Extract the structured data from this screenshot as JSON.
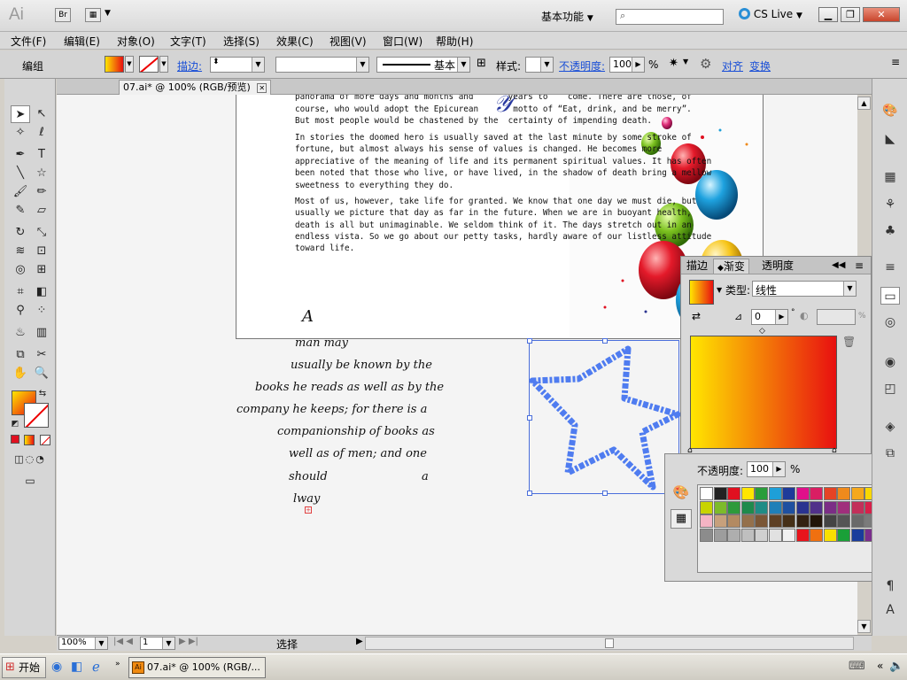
{
  "app": {
    "logo": "Ai",
    "bridge_label": "Br",
    "workspace": "基本功能",
    "cs_live": "CS Live"
  },
  "menu": [
    "文件(F)",
    "编辑(E)",
    "对象(O)",
    "文字(T)",
    "选择(S)",
    "效果(C)",
    "视图(V)",
    "窗口(W)",
    "帮助(H)"
  ],
  "control": {
    "mode": "编组",
    "stroke_label": "描边:",
    "stroke_style": "基本",
    "style_label": "样式:",
    "opacity_label": "不透明度:",
    "opacity_value": "100",
    "opacity_unit": "%",
    "align_link": "对齐",
    "transform_link": "变换"
  },
  "document": {
    "tab": "07.ai* @ 100% (RGB/预览)"
  },
  "artboard_text": {
    "top_fragment_1": "panorama of more days and months and       years to    come. There are those, of",
    "top_fragment_2": "course, who would adopt the Epicurean       motto of “Eat, drink, and be merry”.",
    "top_fragment_3": "But most people would be chastened by the  certainty of impending death.",
    "para2": [
      "In stories the doomed hero is usually saved at the last minute by some stroke of",
      "fortune, but almost always his sense of values is changed. He becomes more",
      "appreciative of the meaning of life and its permanent spiritual values. It has often",
      "been noted that those who live, or have lived, in the shadow of death bring a mellow",
      "sweetness to everything they do."
    ],
    "para3": [
      "Most of us, however, take life for granted. We know that one day we must die, but",
      "usually we picture that day as far in the future. When we are in buoyant health,",
      "death is all but unimaginable. We seldom think of it. The days stretch out in an",
      "endless vista. So we go about our petty tasks, hardly aware of our listless attitude",
      "toward life."
    ]
  },
  "script_text": [
    "A",
    "man may",
    "usually be known by the",
    "books he reads as well as by the",
    "company he keeps; for there is a",
    "companionship of books as",
    "well as of men; and one",
    "should",
    "a",
    "lway"
  ],
  "gradient_panel": {
    "tabs": [
      "描边",
      "渐变",
      "透明度"
    ],
    "type_label": "类型:",
    "type_value": "线性",
    "angle_value": "0",
    "ratio_unit": "%",
    "start_color": "#ffe600",
    "end_color": "#e81010"
  },
  "swatch_panel": {
    "opacity_label": "不透明度:",
    "opacity_value": "100",
    "opacity_unit": "%",
    "swatches": [
      "#ffffff",
      "#222222",
      "#e01020",
      "#ffe600",
      "#2a9d3a",
      "#1e9fd8",
      "#1e3b9a",
      "#e0108a",
      "#d91e63",
      "#e54325",
      "#ef8a1c",
      "#f5a81c",
      "#f9d800",
      "#c8d400",
      "#7dbb2a",
      "#2e9a3b",
      "#1f8a4c",
      "#1f8c86",
      "#1f7fb8",
      "#1f50a0",
      "#2a3390",
      "#51318a",
      "#7b2e86",
      "#a02f7c",
      "#c2305a",
      "#d8204a",
      "#f4b4c4",
      "#c7a07c",
      "#b38a62",
      "#94704c",
      "#7a5636",
      "#5e4024",
      "#463018",
      "#332112",
      "#221509",
      "#444444",
      "#555555",
      "#6a6a6a",
      "#7b7b7b",
      "#8c8c8c",
      "#9d9d9d",
      "#aeaeae",
      "#bfbfbf",
      "#d0d0d0",
      "#e1e1e1",
      "#f2f2f2",
      "#e8141c",
      "#f07010",
      "#f8e000",
      "#1aa038",
      "#1a3c9c",
      "#7a2e8c"
    ]
  },
  "status": {
    "zoom": "100%",
    "page": "1",
    "mode": "选择"
  },
  "taskbar": {
    "start": "开始",
    "task": "07.ai* @ 100% (RGB/..."
  }
}
